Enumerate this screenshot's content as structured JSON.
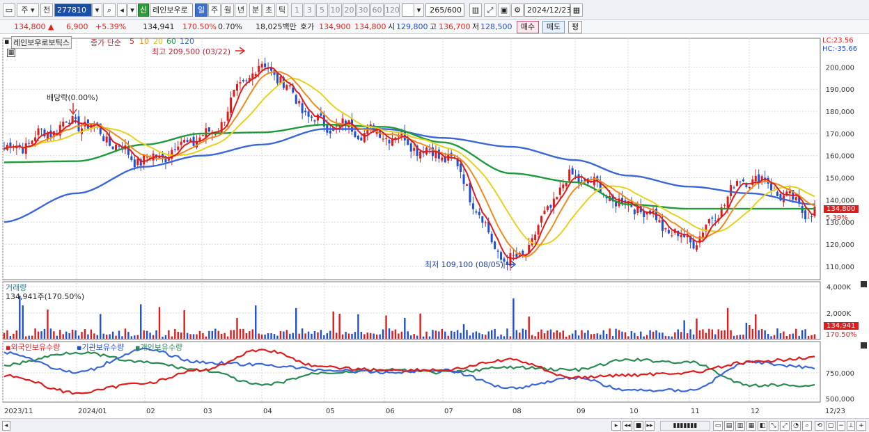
{
  "toolbar": {
    "market": "주",
    "prev": "전",
    "code": "277810",
    "sin": "신",
    "name": "레인보우로",
    "periods": [
      "일",
      "주",
      "월",
      "년",
      "분",
      "초",
      "틱"
    ],
    "active_period": "일",
    "minute_options": [
      "1",
      "3",
      "5",
      "10",
      "20",
      "30",
      "60",
      "120"
    ],
    "count": "265",
    "count_total": "/600",
    "date": "2024/12/23"
  },
  "quote": {
    "price": "134,800",
    "change": "6,900",
    "change_pct": "+5.39%",
    "volume": "134,941",
    "vol_ratio": "170.50%",
    "turnover_pct": "0.70%",
    "amount": "18,025백만",
    "ask_label": "호가",
    "ask": "134,900",
    "bid": "134,800",
    "open_label": "시",
    "open": "129,800",
    "high_label": "고",
    "high": "136,700",
    "low_label": "저",
    "low": "128,500",
    "buy_btn": "매수",
    "sell_btn": "매도",
    "eval_btn": "평"
  },
  "chart": {
    "stock_name": "레인보우로보틱스",
    "ma_prefix": "종가 단순",
    "ma_periods": [
      "5",
      "10",
      "20",
      "60",
      "120"
    ],
    "colors": {
      "ma5": "#e01b1b",
      "ma10": "#f08a1c",
      "ma20": "#e6d21b",
      "ma60": "#1f9a3a",
      "ma120": "#3a66d8",
      "up": "#e01b1b",
      "down": "#1f4fd6"
    },
    "max_label": "최고 209,500 (03/22)",
    "min_label": "최저 109,100 (08/05)",
    "dividend_label": "배당락(0.00%)",
    "lc": "LC:23.56",
    "hc": "HC:-35.66",
    "last_price_tag": "134,800",
    "last_pct_tag": "5.39%",
    "price_axis": [
      "200,000",
      "190,000",
      "180,000",
      "170,000",
      "160,000",
      "150,000",
      "140,000",
      "130,000",
      "120,000",
      "110,000"
    ],
    "volume_title": "거래량",
    "volume_note": "134,941주(170.50%)",
    "volume_axis": [
      "4,000K",
      "2,000K"
    ],
    "vol_tag": "134,941",
    "vol_pct_tag": "170.50%",
    "holdings_title": [
      "외국인보유수량",
      "기관보유수량",
      "개인보유수량"
    ],
    "holdings_axis": [
      "750,000",
      "500,000"
    ],
    "x_labels": [
      "2023/11",
      "2024/01",
      "02",
      "03",
      "04",
      "05",
      "06",
      "07",
      "08",
      "09",
      "10",
      "11",
      "12",
      "12/23"
    ]
  },
  "chart_data": {
    "type": "line",
    "title": "레인보우로보틱스",
    "x": [
      "2023/11",
      "2024/01",
      "02",
      "03",
      "04",
      "05",
      "06",
      "07",
      "08",
      "09",
      "10",
      "11",
      "12",
      "12/23"
    ],
    "series": [
      {
        "name": "종가",
        "values": [
          163000,
          175000,
          158000,
          168000,
          200000,
          174000,
          170000,
          160000,
          112000,
          150000,
          138000,
          122000,
          150000,
          134800
        ]
      },
      {
        "name": "5",
        "values": [
          165000,
          172000,
          160000,
          170000,
          197000,
          176000,
          171000,
          162000,
          118000,
          148000,
          138000,
          124000,
          145000,
          132000
        ]
      },
      {
        "name": "60",
        "values": [
          157000,
          157500,
          165000,
          170000,
          170500,
          174000,
          173000,
          166000,
          152000,
          148000,
          138000,
          136000,
          136000,
          136000
        ]
      },
      {
        "name": "120",
        "values": [
          130000,
          143000,
          155000,
          160000,
          165000,
          172000,
          172000,
          168000,
          164000,
          158000,
          151000,
          146000,
          143000,
          138000
        ]
      }
    ],
    "max": {
      "value": 209500,
      "date": "03/22"
    },
    "min": {
      "value": 109100,
      "date": "08/05"
    },
    "ylim": [
      104000,
      213000
    ],
    "grid": true
  }
}
